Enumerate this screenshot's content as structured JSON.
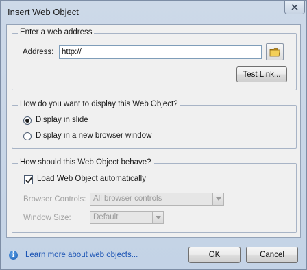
{
  "dialog": {
    "title": "Insert Web Object"
  },
  "web_address": {
    "legend": "Enter a web address",
    "address_label": "Address:",
    "address_value": "http://",
    "test_link_label": "Test Link..."
  },
  "display": {
    "legend": "How do you want to display this Web Object?",
    "options": [
      {
        "label": "Display in slide",
        "checked": true
      },
      {
        "label": "Display in a new browser window",
        "checked": false
      }
    ]
  },
  "behavior": {
    "legend": "How should this Web Object behave?",
    "load_automatically_label": "Load Web Object automatically",
    "load_automatically_checked": true,
    "browser_controls_label": "Browser Controls:",
    "browser_controls_value": "All browser controls",
    "window_size_label": "Window Size:",
    "window_size_value": "Default"
  },
  "footer": {
    "learn_more_label": "Learn more about web objects...",
    "ok_label": "OK",
    "cancel_label": "Cancel"
  }
}
